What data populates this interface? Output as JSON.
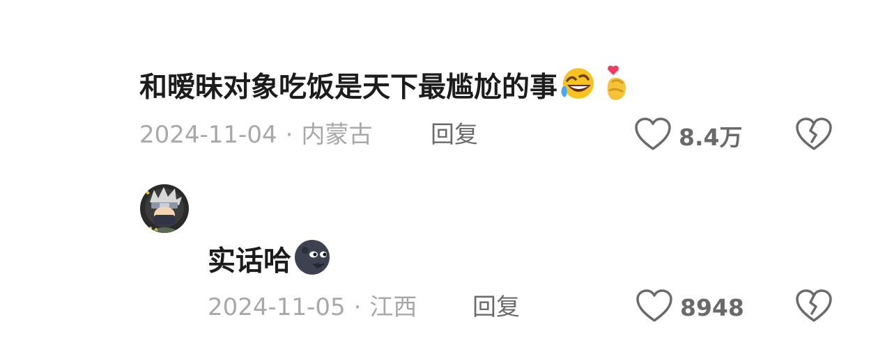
{
  "comments": [
    {
      "text": "和暧昧对象吃饭是天下最尴尬的事",
      "emojis": [
        "rolling-laughing-emoji",
        "finger-heart-emoji"
      ],
      "date": "2024-11-04",
      "location": "内蒙古",
      "reply_label": "回复",
      "likes": "8.4万"
    },
    {
      "avatar": "anime-ninja-avatar",
      "text": "实话哈",
      "emojis": [
        "new-moon-face-emoji"
      ],
      "date": "2024-11-05",
      "location": "江西",
      "reply_label": "回复",
      "likes": "8948"
    }
  ],
  "separator": "·",
  "colors": {
    "text": "#1c1c1c",
    "meta": "#a8a8a8",
    "action": "#6a6a6a"
  }
}
